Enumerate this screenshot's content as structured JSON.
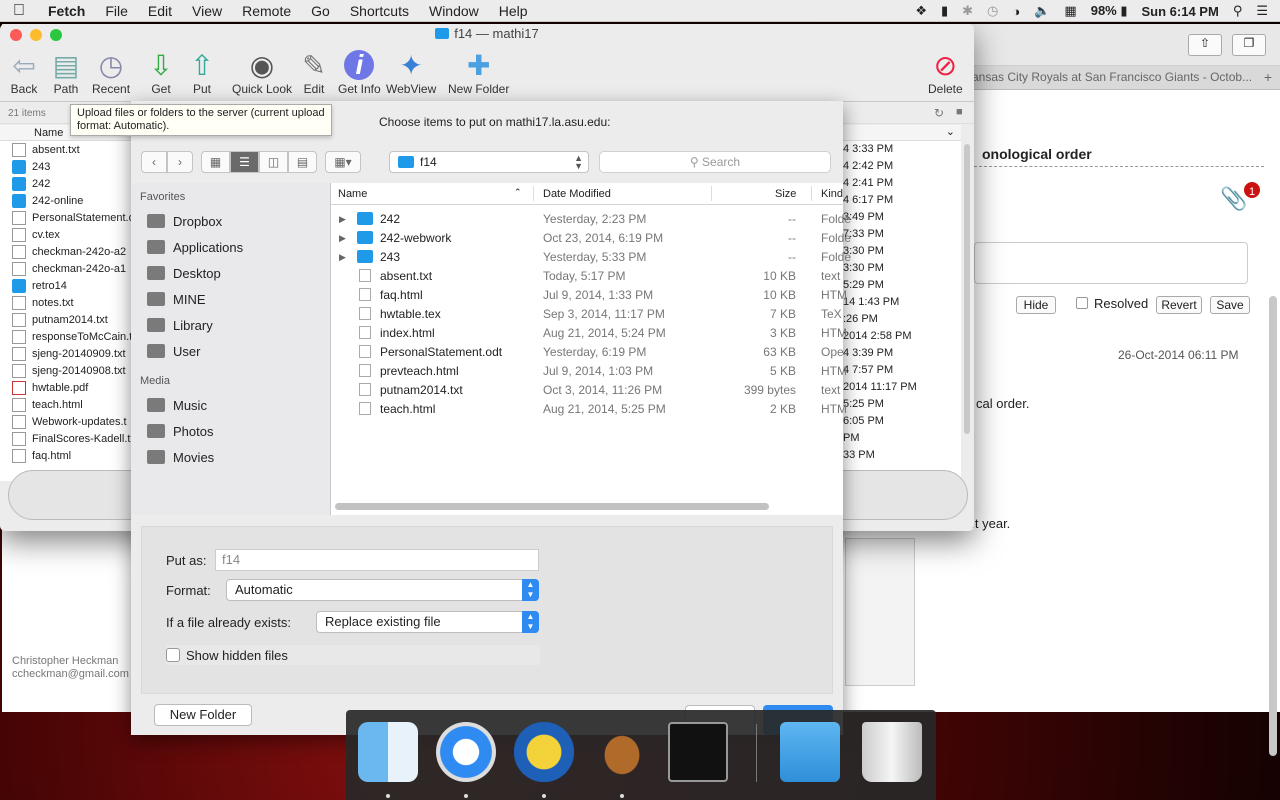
{
  "menubar": {
    "app_name": "Fetch",
    "items": [
      "File",
      "Edit",
      "View",
      "Remote",
      "Go",
      "Shortcuts",
      "Window",
      "Help"
    ],
    "battery": "98%",
    "clock": "Sun 6:14 PM"
  },
  "browser": {
    "tab_title": "ansas City Royals at San Francisco Giants - Octob...",
    "heading": "onological order",
    "badge_count": "1",
    "buttons": {
      "hide": "Hide",
      "resolved": "Resolved",
      "revert": "Revert",
      "save": "Save"
    },
    "timestamp": "26-Oct-2014 06:11 PM",
    "body_line1": "cal order.",
    "body_line2": "it year.",
    "author_name": "Christopher Heckman",
    "author_email": "ccheckman@gmail.com"
  },
  "fetch": {
    "window_title": "f14 — mathi17",
    "toolbar": [
      {
        "name": "back-button",
        "label": "Back",
        "icon": "back-arrow-icon"
      },
      {
        "name": "path-button",
        "label": "Path",
        "icon": "path-icon"
      },
      {
        "name": "recent-button",
        "label": "Recent",
        "icon": "recent-icon"
      },
      {
        "name": "get-button",
        "label": "Get",
        "icon": "get-icon"
      },
      {
        "name": "put-button",
        "label": "Put",
        "icon": "put-icon"
      },
      {
        "name": "quick-look-button",
        "label": "Quick Look",
        "icon": "eye-icon"
      },
      {
        "name": "edit-button",
        "label": "Edit",
        "icon": "edit-icon"
      },
      {
        "name": "get-info-button",
        "label": "Get Info",
        "icon": "info-icon"
      },
      {
        "name": "webview-button",
        "label": "WebView",
        "icon": "compass-icon"
      },
      {
        "name": "new-folder-button",
        "label": "New Folder",
        "icon": "new-folder-icon"
      },
      {
        "name": "delete-button",
        "label": "Delete",
        "icon": "delete-icon"
      }
    ],
    "item_count": "21 items",
    "name_header": "Name",
    "tooltip": "Upload files or folders to the server (current upload format: Automatic).",
    "files": [
      {
        "name": "absent.txt",
        "type": "doc"
      },
      {
        "name": "243",
        "type": "folder"
      },
      {
        "name": "242",
        "type": "folder"
      },
      {
        "name": "242-online",
        "type": "folder"
      },
      {
        "name": "PersonalStatement.odt",
        "type": "doc"
      },
      {
        "name": "cv.tex",
        "type": "doc"
      },
      {
        "name": "checkman-242o-a2",
        "type": "doc"
      },
      {
        "name": "checkman-242o-a1",
        "type": "doc"
      },
      {
        "name": "retro14",
        "type": "folder"
      },
      {
        "name": "notes.txt",
        "type": "doc"
      },
      {
        "name": "putnam2014.txt",
        "type": "doc"
      },
      {
        "name": "responseToMcCain.t",
        "type": "doc"
      },
      {
        "name": "sjeng-20140909.txt",
        "type": "doc"
      },
      {
        "name": "sjeng-20140908.txt",
        "type": "doc"
      },
      {
        "name": "hwtable.pdf",
        "type": "pdf"
      },
      {
        "name": "teach.html",
        "type": "doc"
      },
      {
        "name": "Webwork-updates.t",
        "type": "doc"
      },
      {
        "name": "FinalScores-Kadell.t",
        "type": "doc"
      },
      {
        "name": "faq.html",
        "type": "doc"
      }
    ],
    "dates": [
      "4 3:33 PM",
      "4 2:42 PM",
      "4 2:41 PM",
      "4 6:17 PM",
      "3:49 PM",
      "7:33 PM",
      "3:30 PM",
      "3:30 PM",
      "5:29 PM",
      "14 1:43 PM",
      ":26 PM",
      "2014 2:58 PM",
      "4 3:39 PM",
      "4 7:57 PM",
      "2014 11:17 PM",
      "5:25 PM",
      "6:05 PM",
      "PM",
      "33 PM"
    ]
  },
  "sheet": {
    "message": "Choose items to put on mathi17.la.asu.edu:",
    "current_folder": "f14",
    "search_placeholder": "Search",
    "sidebar": {
      "favorites_heading": "Favorites",
      "favorites": [
        {
          "label": "Dropbox",
          "icon": "dropbox-folder-icon"
        },
        {
          "label": "Applications",
          "icon": "applications-icon"
        },
        {
          "label": "Desktop",
          "icon": "desktop-icon"
        },
        {
          "label": "MINE",
          "icon": "folder-icon"
        },
        {
          "label": "Library",
          "icon": "folder-icon"
        },
        {
          "label": "User",
          "icon": "home-icon"
        }
      ],
      "media_heading": "Media",
      "media": [
        {
          "label": "Music",
          "icon": "music-icon"
        },
        {
          "label": "Photos",
          "icon": "camera-icon"
        },
        {
          "label": "Movies",
          "icon": "film-icon"
        }
      ]
    },
    "columns": {
      "name": "Name",
      "date": "Date Modified",
      "size": "Size",
      "kind": "Kind"
    },
    "rows": [
      {
        "name": "242",
        "date": "Yesterday, 2:23 PM",
        "size": "--",
        "kind": "Folde",
        "folder": true
      },
      {
        "name": "242-webwork",
        "date": "Oct 23, 2014, 6:19 PM",
        "size": "--",
        "kind": "Folde",
        "folder": true
      },
      {
        "name": "243",
        "date": "Yesterday, 5:33 PM",
        "size": "--",
        "kind": "Folde",
        "folder": true
      },
      {
        "name": "absent.txt",
        "date": "Today, 5:17 PM",
        "size": "10 KB",
        "kind": "text",
        "folder": false
      },
      {
        "name": "faq.html",
        "date": "Jul 9, 2014, 1:33 PM",
        "size": "10 KB",
        "kind": "HTM",
        "folder": false
      },
      {
        "name": "hwtable.tex",
        "date": "Sep 3, 2014, 11:17 PM",
        "size": "7 KB",
        "kind": "TeX",
        "folder": false
      },
      {
        "name": "index.html",
        "date": "Aug 21, 2014, 5:24 PM",
        "size": "3 KB",
        "kind": "HTM",
        "folder": false
      },
      {
        "name": "PersonalStatement.odt",
        "date": "Yesterday, 6:19 PM",
        "size": "63 KB",
        "kind": "Ope",
        "folder": false
      },
      {
        "name": "prevteach.html",
        "date": "Jul 9, 2014, 1:03 PM",
        "size": "5 KB",
        "kind": "HTM",
        "folder": false
      },
      {
        "name": "putnam2014.txt",
        "date": "Oct 3, 2014, 11:26 PM",
        "size": "399 bytes",
        "kind": "text",
        "folder": false
      },
      {
        "name": "teach.html",
        "date": "Aug 21, 2014, 5:25 PM",
        "size": "2 KB",
        "kind": "HTM",
        "folder": false
      }
    ],
    "options": {
      "put_as_label": "Put as:",
      "put_as_placeholder": "f14",
      "format_label": "Format:",
      "format_value": "Automatic",
      "exists_label": "If a file already exists:",
      "exists_value": "Replace existing file",
      "show_hidden_label": "Show hidden files"
    },
    "new_folder_label": "New Folder"
  },
  "dock": [
    {
      "name": "finder",
      "icon": "finder-icon",
      "running": true
    },
    {
      "name": "safari",
      "icon": "safari-icon",
      "running": true
    },
    {
      "name": "bbedit",
      "icon": "editor-icon",
      "running": true
    },
    {
      "name": "fetch",
      "icon": "fetch-dog-icon",
      "running": true
    },
    {
      "name": "terminal",
      "icon": "terminal-icon",
      "running": false
    },
    {
      "name": "applications-folder",
      "icon": "applications-folder-icon",
      "running": false
    },
    {
      "name": "trash",
      "icon": "trash-icon",
      "running": false
    }
  ],
  "colors": {
    "accent": "#2f8bf2",
    "folder": "#1e9ae8",
    "badge": "#cc1111"
  }
}
